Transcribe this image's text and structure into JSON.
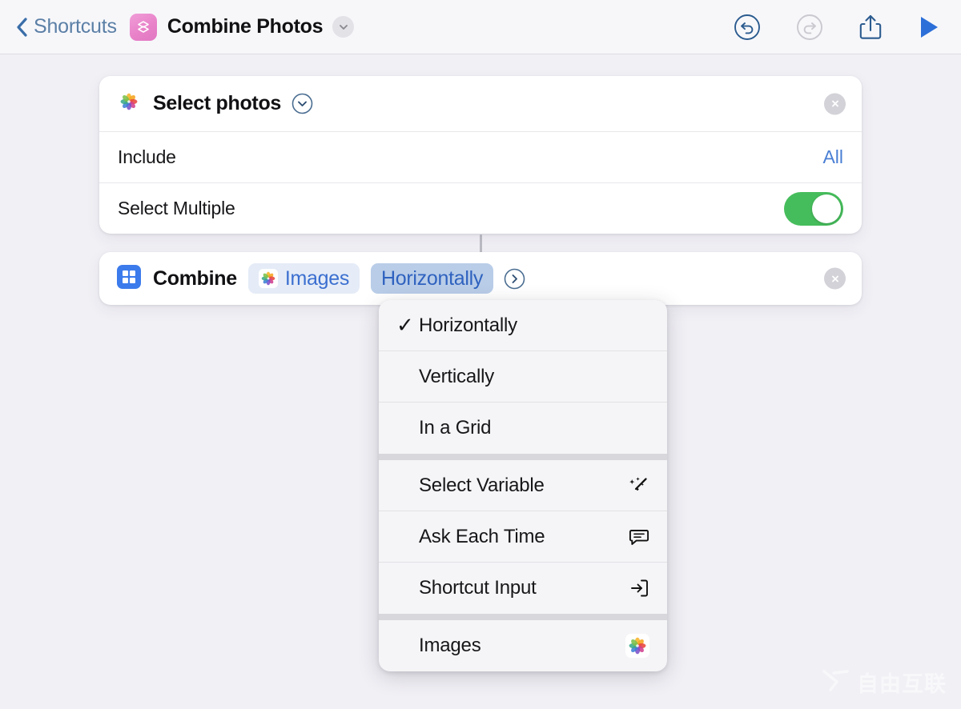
{
  "toolbar": {
    "back_label": "Shortcuts",
    "back_icon": "chevron-left-icon",
    "app_icon": "shortcuts-app-icon",
    "title": "Combine Photos",
    "title_chevron_icon": "chevron-down-icon",
    "undo_icon": "undo-circle-icon",
    "redo_icon": "redo-circle-icon",
    "share_icon": "share-icon",
    "run_icon": "play-icon",
    "undo_enabled": true,
    "redo_enabled": false,
    "colors": {
      "accent_blue": "#2f62bf",
      "link_blue": "#4a7fd4",
      "back_blue": "#5b7fa6",
      "toggle_green": "#46bd5c",
      "app_pink": "#e982c9",
      "background": "#f1f0f5"
    }
  },
  "actions": [
    {
      "icon": "photos-app-icon",
      "title": "Select photos",
      "disclosure_icon": "chevron-down-circle-icon",
      "close_icon": "close-circle-icon",
      "rows": [
        {
          "label": "Include",
          "value": "All",
          "type": "value"
        },
        {
          "label": "Select Multiple",
          "value": "on",
          "type": "toggle"
        }
      ]
    },
    {
      "icon": "combine-grid-icon",
      "title": "Combine",
      "input_pill": {
        "icon": "photos-app-icon",
        "label": "Images"
      },
      "mode_pill": {
        "label": "Horizontally"
      },
      "disclosure_icon": "chevron-right-circle-icon",
      "close_icon": "close-circle-icon"
    }
  ],
  "menu": {
    "groups": [
      {
        "items": [
          {
            "label": "Horizontally",
            "checked": true,
            "trail_icon": ""
          },
          {
            "label": "Vertically",
            "checked": false,
            "trail_icon": ""
          },
          {
            "label": "In a Grid",
            "checked": false,
            "trail_icon": ""
          }
        ]
      },
      {
        "items": [
          {
            "label": "Select Variable",
            "checked": false,
            "trail_icon": "magic-wand-icon"
          },
          {
            "label": "Ask Each Time",
            "checked": false,
            "trail_icon": "speech-bubble-icon"
          },
          {
            "label": "Shortcut Input",
            "checked": false,
            "trail_icon": "arrow-into-box-icon"
          }
        ]
      },
      {
        "items": [
          {
            "label": "Images",
            "checked": false,
            "trail_icon": "photos-app-icon"
          }
        ]
      }
    ]
  },
  "watermark": {
    "text": "自由互联",
    "logo_icon": "x-logo-icon"
  }
}
